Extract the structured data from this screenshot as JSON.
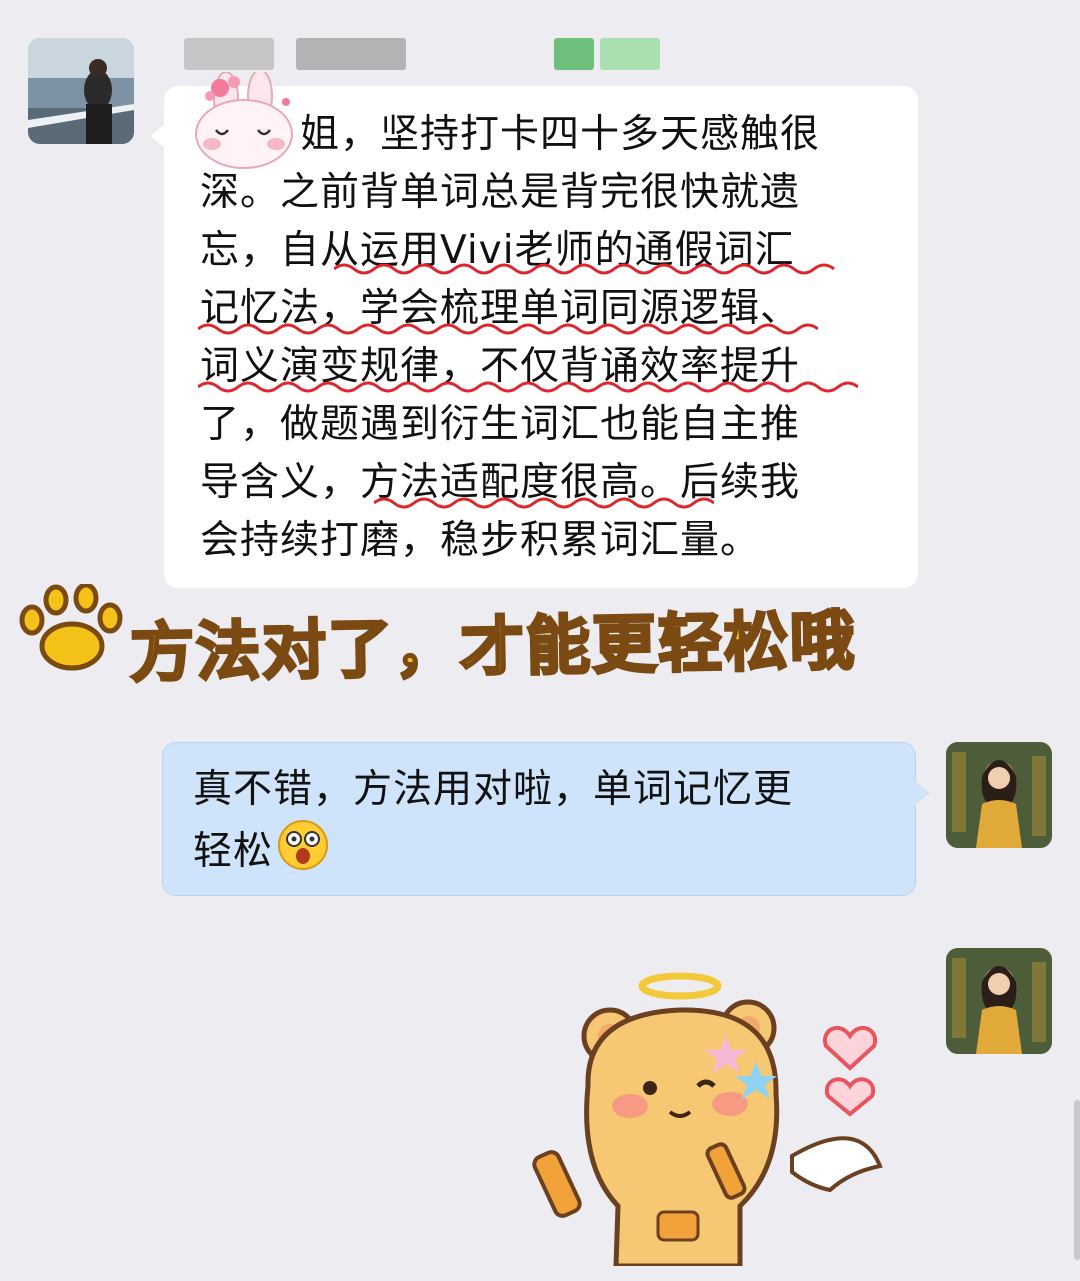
{
  "chat": {
    "sender_name": "",
    "message1": {
      "lines": [
        "姐，坚持打卡四十多天感触很",
        "深。之前背单词总是背完很快就遗",
        "忘，自从运用Vivi老师的通假词汇",
        "记忆法，学会梳理单词同源逻辑、",
        "词义演变规律，不仅背诵效率提升",
        "了，做题遇到衍生词汇也能自主推",
        "导含义，方法适配度很高。后续我",
        "会持续打磨，稳步积累词汇量。"
      ]
    },
    "sticker_caption": "方法对了，才能更轻松哦",
    "message2": {
      "lines": [
        "真不错，方法用对啦，单词记忆更",
        "轻松"
      ],
      "emoji": "😲"
    }
  },
  "colors": {
    "background": "#ededf1",
    "bubble_left": "#ffffff",
    "bubble_right": "#cfe4fb",
    "underline": "#e0242b",
    "caption_fill": "#f5c21a",
    "caption_stroke": "#7a4a12"
  },
  "icons": [
    "paw-icon",
    "bunny-sticker-icon",
    "angel-bear-sticker",
    "heart-icon",
    "star-icon",
    "dizzy-face-emoji"
  ]
}
